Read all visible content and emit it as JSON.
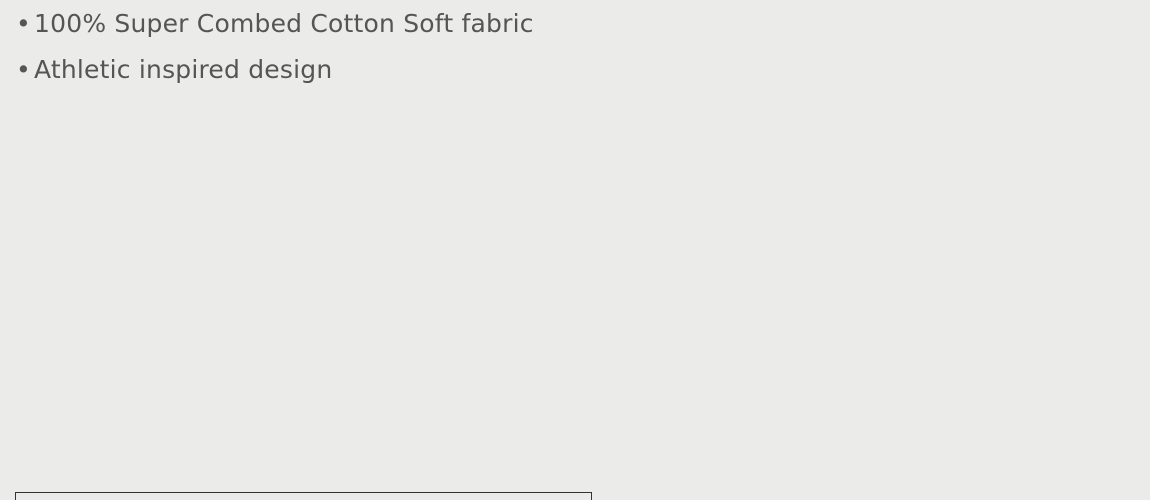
{
  "features": {
    "bullet": "•",
    "items": [
      "100% Super Combed Cotton Soft fabric",
      "Athletic inspired design"
    ]
  }
}
